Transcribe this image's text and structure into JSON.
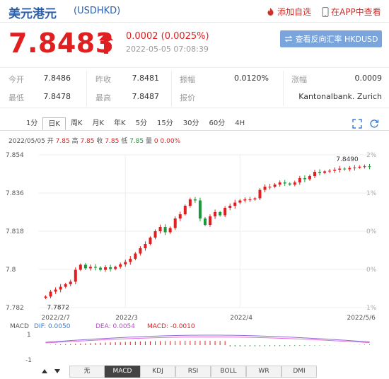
{
  "header": {
    "title": "美元港元",
    "code": "(USDHKD)",
    "add_watch": "添加自选",
    "app_view": "在APP中查看"
  },
  "quote": {
    "price": "7.8483",
    "change": "0.0002 (0.0025%)",
    "timestamp": "2022-05-05 07:08:39",
    "reverse_btn": "查看反向汇率 HKDUSD"
  },
  "stats": [
    {
      "label": "今开",
      "value": "7.8486"
    },
    {
      "label": "昨收",
      "value": "7.8481"
    },
    {
      "label": "振幅",
      "value": "0.0120%"
    },
    {
      "label": "涨幅",
      "value": "0.0009"
    },
    {
      "label": "最低",
      "value": "7.8478"
    },
    {
      "label": "最高",
      "value": "7.8487"
    },
    {
      "label": "报价",
      "value": "Kantonalbank. Zurich"
    }
  ],
  "tabs": [
    "1分",
    "日K",
    "周K",
    "月K",
    "年K",
    "5分",
    "15分",
    "30分",
    "60分",
    "4H"
  ],
  "active_tab": "日K",
  "bar_info": {
    "date": "2022/05/05",
    "open_label": "开",
    "open": "7.85",
    "high_label": "高",
    "high": "7.85",
    "close_label": "收",
    "close": "7.85",
    "low_label": "低",
    "low": "7.85",
    "vol_label": "量",
    "vol": "0",
    "pct": "0.00%"
  },
  "chart_data": {
    "type": "candlestick",
    "y_ticks": [
      "7.854",
      "7.836",
      "7.818",
      "7.8",
      "7.782"
    ],
    "y_tick_values": [
      7.854,
      7.836,
      7.818,
      7.8,
      7.782
    ],
    "right_ticks": [
      "2%",
      "1%",
      "0%",
      "0%",
      "1%"
    ],
    "x_labels": [
      "2022/2/7",
      "2022/3",
      "2022/4",
      "2022/5/6"
    ],
    "ylim": [
      7.782,
      7.854
    ],
    "max_label": "7.8490",
    "min_label": "7.7872",
    "closes": [
      7.7872,
      7.7895,
      7.7905,
      7.7918,
      7.793,
      7.7942,
      7.7998,
      7.8022,
      7.8005,
      7.8012,
      7.8008,
      7.7998,
      7.801,
      7.8002,
      7.8012,
      7.8024,
      7.8035,
      7.805,
      7.8075,
      7.81,
      7.812,
      7.815,
      7.818,
      7.82,
      7.8175,
      7.8195,
      7.824,
      7.826,
      7.83,
      7.833,
      7.8325,
      7.824,
      7.821,
      7.825,
      7.827,
      7.8255,
      7.829,
      7.83,
      7.8315,
      7.8325,
      7.833,
      7.833,
      7.8335,
      7.8375,
      7.839,
      7.839,
      7.84,
      7.841,
      7.8405,
      7.84,
      7.841,
      7.843,
      7.8425,
      7.844,
      7.846,
      7.8455,
      7.8462,
      7.8465,
      7.847,
      7.8475,
      7.8472,
      7.8478,
      7.848,
      7.8484,
      7.8486,
      7.8483
    ]
  },
  "macd": {
    "label": "MACD",
    "dif": "DIF: 0.0050",
    "dea": "DEA: 0.0054",
    "macd": "MACD: -0.0010",
    "y_ticks": [
      "1",
      "-1"
    ]
  },
  "indicator_tabs": [
    "无",
    "MACD",
    "KDJ",
    "RSI",
    "BOLL",
    "WR",
    "DMI"
  ],
  "active_indicator": "MACD"
}
